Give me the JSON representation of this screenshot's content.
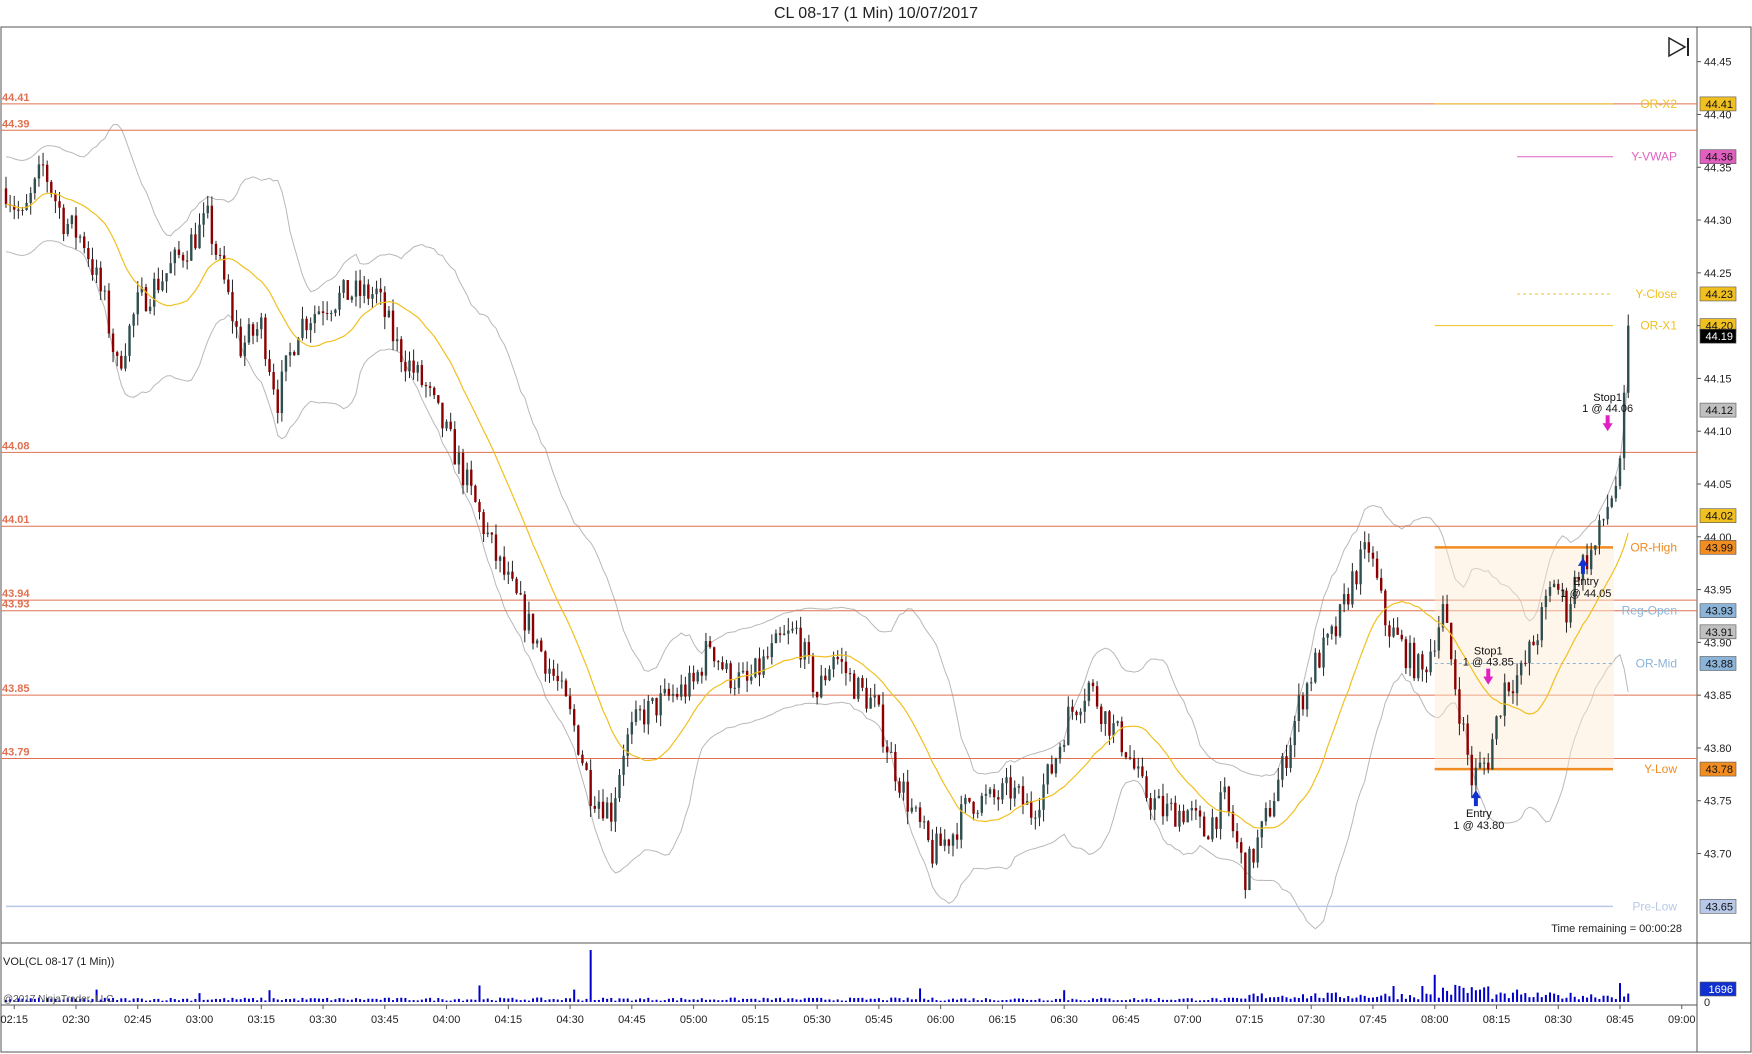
{
  "title": "CL 08-17 (1 Min)  10/07/2017",
  "time_remaining": "Time remaining = 00:00:28",
  "volume_label": "VOL(CL 08-17 (1 Min))",
  "copyright": "@2017 NinjaTrader, LLC",
  "colors": {
    "up": "#2f4f4f",
    "down": "#8b0000",
    "volume": "#0000c8",
    "sma": "#f0c020",
    "band": "#b8b8b8",
    "level_line": "#e07050",
    "level_text": "#e07050"
  },
  "icons": {
    "skip_end": "skip-to-end-icon"
  },
  "chart_data": {
    "type": "candlestick",
    "title": "CL 08-17 (1 Min)  10/07/2017",
    "ylim": [
      43.62,
      44.48
    ],
    "y_ticks": [
      "44.45",
      "44.40",
      "44.35",
      "44.30",
      "44.25",
      "44.20",
      "44.15",
      "44.10",
      "44.05",
      "44.00",
      "43.95",
      "43.90",
      "43.85",
      "43.80",
      "43.75",
      "43.70"
    ],
    "x_ticks": [
      "02:15",
      "02:30",
      "02:45",
      "03:00",
      "03:15",
      "03:30",
      "03:45",
      "04:00",
      "04:15",
      "04:30",
      "04:45",
      "05:00",
      "05:15",
      "05:30",
      "05:45",
      "06:00",
      "06:15",
      "06:30",
      "06:45",
      "07:00",
      "07:15",
      "07:30",
      "07:45",
      "08:00",
      "08:15",
      "08:30",
      "08:45",
      "09:00"
    ],
    "x_range": [
      "02:13",
      "09:02"
    ],
    "price_path": [
      [
        "02:13",
        44.33
      ],
      [
        "02:17",
        44.3
      ],
      [
        "02:22",
        44.35
      ],
      [
        "02:27",
        44.3
      ],
      [
        "02:32",
        44.28
      ],
      [
        "02:37",
        44.22
      ],
      [
        "02:40",
        44.16
      ],
      [
        "02:45",
        44.22
      ],
      [
        "02:52",
        44.25
      ],
      [
        "02:58",
        44.28
      ],
      [
        "03:02",
        44.3
      ],
      [
        "03:06",
        44.24
      ],
      [
        "03:10",
        44.18
      ],
      [
        "03:15",
        44.2
      ],
      [
        "03:19",
        44.13
      ],
      [
        "03:24",
        44.2
      ],
      [
        "03:30",
        44.22
      ],
      [
        "03:36",
        44.23
      ],
      [
        "03:43",
        44.23
      ],
      [
        "03:48",
        44.18
      ],
      [
        "03:55",
        44.14
      ],
      [
        "04:02",
        44.08
      ],
      [
        "04:07",
        44.03
      ],
      [
        "04:12",
        43.98
      ],
      [
        "04:17",
        43.94
      ],
      [
        "04:22",
        43.9
      ],
      [
        "04:27",
        43.86
      ],
      [
        "04:31",
        43.82
      ],
      [
        "04:35",
        43.76
      ],
      [
        "04:40",
        43.74
      ],
      [
        "04:43",
        43.8
      ],
      [
        "04:47",
        43.83
      ],
      [
        "04:55",
        43.85
      ],
      [
        "05:00",
        43.86
      ],
      [
        "05:04",
        43.9
      ],
      [
        "05:08",
        43.87
      ],
      [
        "05:13",
        43.86
      ],
      [
        "05:17",
        43.88
      ],
      [
        "05:21",
        43.9
      ],
      [
        "05:25",
        43.91
      ],
      [
        "05:30",
        43.85
      ],
      [
        "05:34",
        43.89
      ],
      [
        "05:39",
        43.86
      ],
      [
        "05:44",
        43.84
      ],
      [
        "05:48",
        43.79
      ],
      [
        "05:53",
        43.74
      ],
      [
        "05:58",
        43.7
      ],
      [
        "06:03",
        43.72
      ],
      [
        "06:07",
        43.75
      ],
      [
        "06:12",
        43.75
      ],
      [
        "06:17",
        43.76
      ],
      [
        "06:22",
        43.74
      ],
      [
        "06:27",
        43.78
      ],
      [
        "06:31",
        43.83
      ],
      [
        "06:36",
        43.86
      ],
      [
        "06:40",
        43.83
      ],
      [
        "06:45",
        43.8
      ],
      [
        "06:49",
        43.76
      ],
      [
        "06:54",
        43.74
      ],
      [
        "07:00",
        43.74
      ],
      [
        "07:04",
        43.72
      ],
      [
        "07:09",
        43.75
      ],
      [
        "07:14",
        43.68
      ],
      [
        "07:18",
        43.72
      ],
      [
        "07:23",
        43.78
      ],
      [
        "07:27",
        43.84
      ],
      [
        "07:31",
        43.88
      ],
      [
        "07:36",
        43.91
      ],
      [
        "07:40",
        43.96
      ],
      [
        "07:44",
        43.99
      ],
      [
        "07:48",
        43.92
      ],
      [
        "07:53",
        43.89
      ],
      [
        "07:57",
        43.87
      ],
      [
        "08:02",
        43.93
      ],
      [
        "08:05",
        43.86
      ],
      [
        "08:09",
        43.77
      ],
      [
        "08:13",
        43.79
      ],
      [
        "08:17",
        43.86
      ],
      [
        "08:21",
        43.87
      ],
      [
        "08:25",
        43.91
      ],
      [
        "08:29",
        43.96
      ],
      [
        "08:32",
        43.93
      ],
      [
        "08:35",
        43.97
      ],
      [
        "08:39",
        43.99
      ],
      [
        "08:42",
        44.03
      ],
      [
        "08:45",
        44.06
      ],
      [
        "08:47",
        44.19
      ]
    ],
    "level_lines": [
      {
        "label": "44.41",
        "value": 44.41
      },
      {
        "label": "44.39",
        "value": 44.385
      },
      {
        "label": "44.08",
        "value": 44.08
      },
      {
        "label": "44.01",
        "value": 44.01
      },
      {
        "label": "43.94",
        "value": 43.94
      },
      {
        "label": "43.93",
        "value": 43.93
      },
      {
        "label": "43.85",
        "value": 43.85
      },
      {
        "label": "43.79",
        "value": 43.79
      }
    ],
    "right_levels": [
      {
        "name": "OR-X2",
        "tag": "44.41",
        "value": 44.41,
        "color": "#f0c020",
        "tag_color": "#f0c020",
        "style": "solid"
      },
      {
        "name": "Y-VWAP",
        "tag": "44.36",
        "value": 44.36,
        "color": "#e060c0",
        "tag_color": "#e060c0",
        "style": "solid"
      },
      {
        "name": "Y-Close",
        "tag": "44.23",
        "value": 44.23,
        "color": "#f0c020",
        "tag_color": "#f0c020",
        "style": "dotted"
      },
      {
        "name": "OR-X1",
        "tag": "44.20",
        "value": 44.2,
        "color": "#f0c020",
        "tag_color": "#f0c020",
        "style": "solid"
      },
      {
        "name": "OR-High",
        "tag": "43.99",
        "value": 43.99,
        "color": "#f08c20",
        "tag_color": "#f08c20",
        "style": "thick"
      },
      {
        "name": "Reg-Open",
        "tag": "43.93",
        "value": 43.93,
        "color": "#8cb4d8",
        "tag_color": "#8cb4d8",
        "style": "none"
      },
      {
        "name": "OR-Mid",
        "tag": "43.88",
        "value": 43.88,
        "color": "#8cb4d8",
        "tag_color": "#8cb4d8",
        "style": "dotted"
      },
      {
        "name": "Y-Low",
        "tag": "43.78",
        "value": 43.78,
        "color": "#f08c20",
        "tag_color": "#f08c20",
        "style": "thick"
      },
      {
        "name": "Pre-Low",
        "tag": "43.65",
        "value": 43.65,
        "color": "#b8c8e8",
        "tag_color": "#b8c8e8",
        "style": "solid"
      }
    ],
    "price_tags": [
      {
        "tag": "44.19",
        "value": 44.19,
        "color": "#000000"
      },
      {
        "tag": "44.12",
        "value": 44.12,
        "color": "#c0c0c0"
      },
      {
        "tag": "44.02",
        "value": 44.02,
        "color": "#f0c020"
      },
      {
        "tag": "43.91",
        "value": 43.91,
        "color": "#c0c0c0"
      }
    ],
    "trades": [
      {
        "label": "Entry",
        "detail": "1 @ 43.80",
        "time": "08:10",
        "value": 43.76,
        "kind": "entry"
      },
      {
        "label": "Stop1",
        "detail": "1 @ 43.85",
        "time": "08:13",
        "value": 43.86,
        "kind": "stop"
      },
      {
        "label": "Entry",
        "detail": "1 @ 44.05",
        "time": "08:36",
        "value": 43.98,
        "kind": "entry"
      },
      {
        "label": "Stop1",
        "detail": "1 @ 44.06",
        "time": "08:42",
        "value": 44.1,
        "kind": "stop"
      }
    ],
    "volume": {
      "name": "VOL(CL 08-17 (1 Min))",
      "last_tag": "1696",
      "zero_tag": "0",
      "max": 4400,
      "base": 300,
      "spikes": [
        [
          "02:35",
          1050
        ],
        [
          "03:00",
          750
        ],
        [
          "03:17",
          1000
        ],
        [
          "04:08",
          1400
        ],
        [
          "04:31",
          1050
        ],
        [
          "04:35",
          4400
        ],
        [
          "05:55",
          1150
        ],
        [
          "06:30",
          1000
        ],
        [
          "07:50",
          1350
        ],
        [
          "07:57",
          1350
        ],
        [
          "08:00",
          2300
        ],
        [
          "08:07",
          1200
        ],
        [
          "08:20",
          1050
        ],
        [
          "08:45",
          1600
        ]
      ],
      "busy_start": "07:15",
      "busy_level": 650,
      "hot_start": "08:02",
      "hot_end": "08:13",
      "hot_level": 1250
    }
  }
}
